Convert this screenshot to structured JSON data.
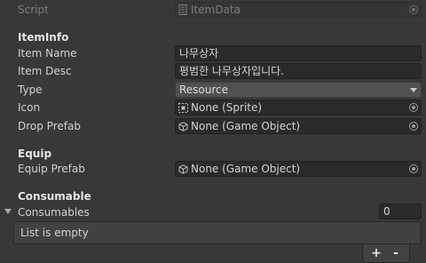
{
  "script": {
    "label": "Script",
    "value": "ItemData"
  },
  "sections": {
    "item_info": "ItemInfo",
    "equip": "Equip",
    "consumable": "Consumable"
  },
  "fields": {
    "item_name": {
      "label": "Item Name",
      "value": "나무상자"
    },
    "item_desc": {
      "label": "Item Desc",
      "value": "평범한 나무상자입니다."
    },
    "type": {
      "label": "Type",
      "value": "Resource"
    },
    "icon": {
      "label": "Icon",
      "value": "None (Sprite)"
    },
    "drop_prefab": {
      "label": "Drop Prefab",
      "value": "None (Game Object)"
    },
    "equip_prefab": {
      "label": "Equip Prefab",
      "value": "None (Game Object)"
    }
  },
  "consumables": {
    "label": "Consumables",
    "count": "0",
    "empty_text": "List is empty",
    "add_label": "+",
    "remove_label": "-"
  },
  "colors": {
    "background": "#383838",
    "field": "#2a2a2a",
    "dropdown": "#515151"
  },
  "icons": [
    "script-icon",
    "object-picker-icon",
    "sprite-icon",
    "game-object-icon",
    "dropdown-caret-icon",
    "foldout-arrow-icon"
  ]
}
